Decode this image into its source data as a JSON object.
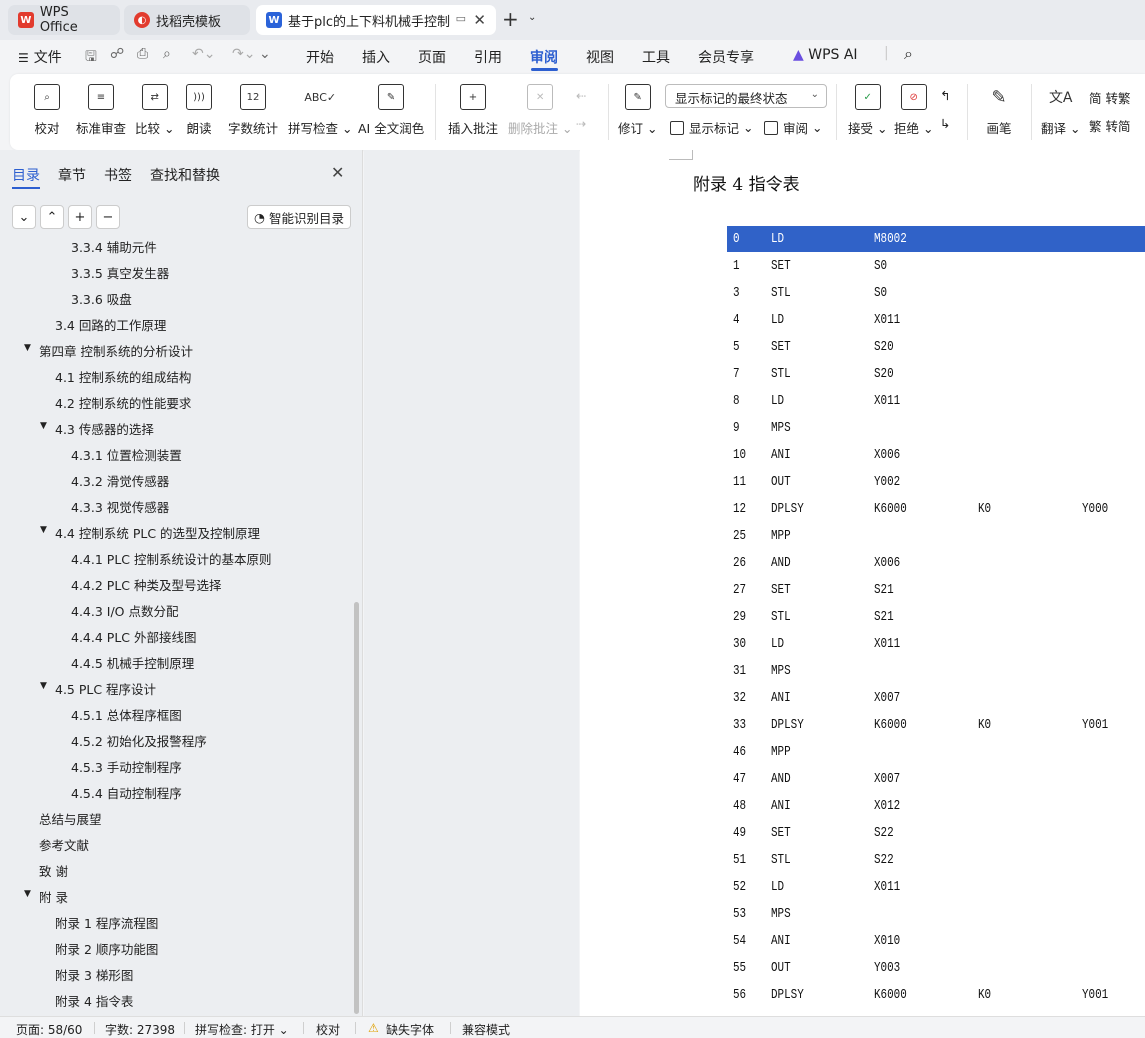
{
  "tabs": {
    "wps_office": "WPS Office",
    "template": "找稻壳模板",
    "document": "基于plc的上下料机械手控制系"
  },
  "menu": {
    "file": "文件",
    "items": [
      "开始",
      "插入",
      "页面",
      "引用",
      "审阅",
      "视图",
      "工具",
      "会员专享",
      "WPS AI"
    ],
    "active": "审阅"
  },
  "ribbon": {
    "proofread": "校对",
    "std_review": "标准审查",
    "compare": "比较",
    "read_aloud": "朗读",
    "word_count": "字数统计",
    "spell_check": "拼写检查",
    "ai_polish": "AI 全文润色",
    "insert_comment": "插入批注",
    "delete_comment": "删除批注",
    "track": "修订",
    "markup_dropdown": "显示标记的最终状态",
    "show_markup": "显示标记",
    "review": "审阅",
    "accept": "接受",
    "reject": "拒绝",
    "pen": "画笔",
    "translate": "翻译",
    "to_traditional": "转繁",
    "to_simplified": "转简"
  },
  "left_panel": {
    "tabs": [
      "目录",
      "章节",
      "书签",
      "查找和替换"
    ],
    "smart_toc": "智能识别目录",
    "toc": [
      {
        "text": "3.3.4   辅助元件",
        "level": 3
      },
      {
        "text": "3.3.5   真空发生器",
        "level": 3
      },
      {
        "text": "3.3.6   吸盘",
        "level": 3
      },
      {
        "text": "3.4   回路的工作原理",
        "level": 2
      },
      {
        "text": "第四章   控制系统的分析设计",
        "level": 1,
        "expanded": true
      },
      {
        "text": "4.1   控制系统的组成结构",
        "level": 2
      },
      {
        "text": "4.2   控制系统的性能要求",
        "level": 2
      },
      {
        "text": "4.3   传感器的选择",
        "level": 2,
        "expanded": true
      },
      {
        "text": "4.3.1   位置检测装置",
        "level": 3
      },
      {
        "text": "4.3.2   滑觉传感器",
        "level": 3
      },
      {
        "text": "4.3.3   视觉传感器",
        "level": 3
      },
      {
        "text": "4.4   控制系统 PLC 的选型及控制原理",
        "level": 2,
        "expanded": true
      },
      {
        "text": "4.4.1   PLC 控制系统设计的基本原则",
        "level": 3
      },
      {
        "text": "4.4.2   PLC 种类及型号选择",
        "level": 3
      },
      {
        "text": "4.4.3   I/O 点数分配",
        "level": 3
      },
      {
        "text": "4.4.4   PLC 外部接线图",
        "level": 3
      },
      {
        "text": "4.4.5   机械手控制原理",
        "level": 3
      },
      {
        "text": "4.5   PLC 程序设计",
        "level": 2,
        "expanded": true
      },
      {
        "text": "4.5.1   总体程序框图",
        "level": 3
      },
      {
        "text": "4.5.2   初始化及报警程序",
        "level": 3
      },
      {
        "text": "4.5.3   手动控制程序",
        "level": 3
      },
      {
        "text": "4.5.4   自动控制程序",
        "level": 3
      },
      {
        "text": "总结与展望",
        "level": 1
      },
      {
        "text": "参考文献",
        "level": 1
      },
      {
        "text": "致   谢",
        "level": 1
      },
      {
        "text": "附   录",
        "level": 1,
        "expanded": true
      },
      {
        "text": "附录 1  程序流程图",
        "level": 2
      },
      {
        "text": "附录 2  顺序功能图",
        "level": 2
      },
      {
        "text": "附录 3  梯形图",
        "level": 2
      },
      {
        "text": "附录 4  指令表",
        "level": 2
      }
    ]
  },
  "document": {
    "heading": "附录 4  指令表",
    "rows": [
      [
        "0",
        "LD",
        "M8002",
        "",
        ""
      ],
      [
        "1",
        "SET",
        "S0",
        "",
        ""
      ],
      [
        "3",
        "STL",
        "S0",
        "",
        ""
      ],
      [
        "4",
        "LD",
        "X011",
        "",
        ""
      ],
      [
        "5",
        "SET",
        "S20",
        "",
        ""
      ],
      [
        "7",
        "STL",
        "S20",
        "",
        ""
      ],
      [
        "8",
        "LD",
        "X011",
        "",
        ""
      ],
      [
        "9",
        "MPS",
        "",
        "",
        ""
      ],
      [
        "10",
        "ANI",
        "X006",
        "",
        ""
      ],
      [
        "11",
        "OUT",
        "Y002",
        "",
        ""
      ],
      [
        "12",
        "DPLSY",
        "K6000",
        "K0",
        "Y000"
      ],
      [
        "25",
        "MPP",
        "",
        "",
        ""
      ],
      [
        "26",
        "AND",
        "X006",
        "",
        ""
      ],
      [
        "27",
        "SET",
        "S21",
        "",
        ""
      ],
      [
        "29",
        "STL",
        "S21",
        "",
        ""
      ],
      [
        "30",
        "LD",
        "X011",
        "",
        ""
      ],
      [
        "31",
        "MPS",
        "",
        "",
        ""
      ],
      [
        "32",
        "ANI",
        "X007",
        "",
        ""
      ],
      [
        "33",
        "DPLSY",
        "K6000",
        "K0",
        "Y001"
      ],
      [
        "46",
        "MPP",
        "",
        "",
        ""
      ],
      [
        "47",
        "AND",
        "X007",
        "",
        ""
      ],
      [
        "48",
        "ANI",
        "X012",
        "",
        ""
      ],
      [
        "49",
        "SET",
        "S22",
        "",
        ""
      ],
      [
        "51",
        "STL",
        "S22",
        "",
        ""
      ],
      [
        "52",
        "LD",
        "X011",
        "",
        ""
      ],
      [
        "53",
        "MPS",
        "",
        "",
        ""
      ],
      [
        "54",
        "ANI",
        "X010",
        "",
        ""
      ],
      [
        "55",
        "OUT",
        "Y003",
        "",
        ""
      ],
      [
        "56",
        "DPLSY",
        "K6000",
        "K0",
        "Y001"
      ]
    ]
  },
  "status": {
    "page": "页面: 58/60",
    "words": "字数: 27398",
    "spell": "拼写检查: 打开",
    "proof": "校对",
    "missing_font": "缺失字体",
    "compat": "兼容模式"
  },
  "colors": {
    "accent": "#2d5fd0",
    "selection": "#3062c8",
    "wps_red": "#e23b2e",
    "word_blue": "#2b63d9"
  }
}
